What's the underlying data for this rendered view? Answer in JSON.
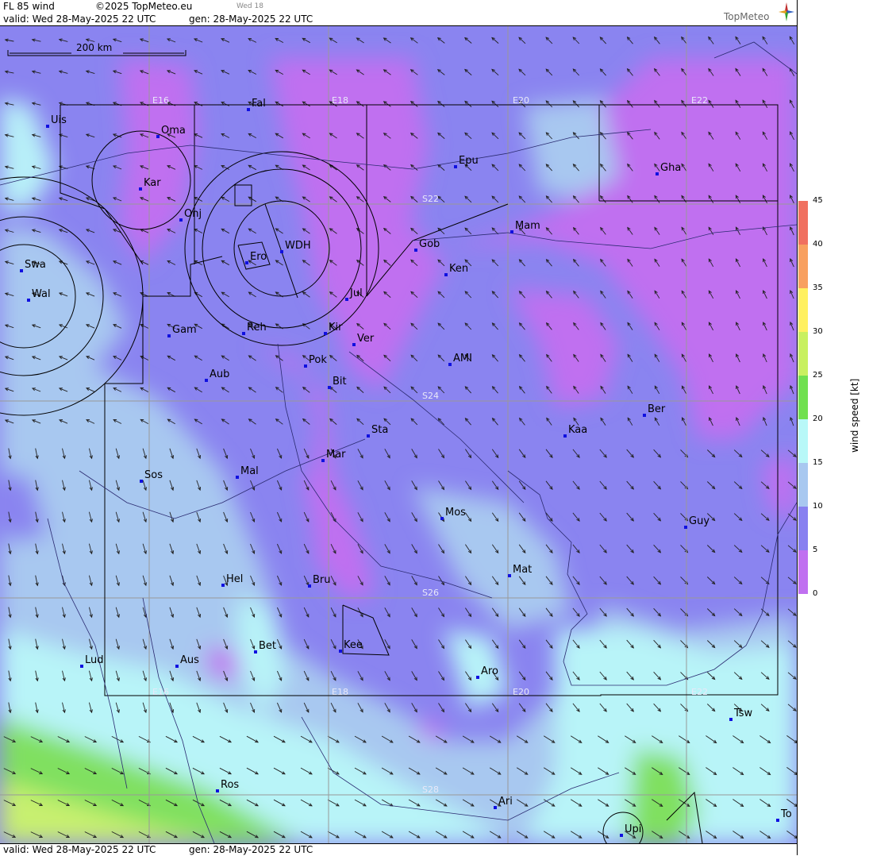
{
  "header": {
    "product": "FL 85 wind",
    "copyright": "©2025 TopMeteo.eu",
    "step": "Wed 18",
    "valid_label": "valid:  Wed  28-May-2025  22 UTC",
    "gen_label": "gen: 28-May-2025 22 UTC",
    "brand": "TopMeteo"
  },
  "footer": {
    "valid_label": "valid:  Wed  28-May-2025  22 UTC",
    "gen_label": "gen: 28-May-2025 22 UTC"
  },
  "scale_bar": {
    "label": "200 km"
  },
  "grid_labels": {
    "lon": [
      "E16",
      "E18",
      "E20",
      "E22"
    ],
    "lat": [
      "S22",
      "S24",
      "S26",
      "S28"
    ]
  },
  "places": [
    "Uis",
    "Fal",
    "Oma",
    "Kar",
    "Onj",
    "Epu",
    "Gha",
    "Mam",
    "Gob",
    "Ken",
    "WDH",
    "Ero",
    "Swa",
    "Wal",
    "Jul",
    "Gam",
    "Reh",
    "Kir",
    "Ver",
    "Pok",
    "AMI",
    "Bit",
    "Aub",
    "Ber",
    "Sta",
    "Kaa",
    "Mar",
    "Sos",
    "Mal",
    "Mos",
    "Guy",
    "Hel",
    "Mat",
    "Bru",
    "Bet",
    "Kee",
    "Lud",
    "Aus",
    "Aro",
    "Tsw",
    "Ros",
    "Ari",
    "Upi",
    "To"
  ],
  "colorbar": {
    "title": "wind speed [kt]",
    "ticks": [
      "45",
      "40",
      "35",
      "30",
      "25",
      "20",
      "15",
      "10",
      "5",
      "0"
    ],
    "colors": [
      "#f07060",
      "#f8a060",
      "#fff060",
      "#c8f060",
      "#70e050",
      "#b8f8f8",
      "#a8c8f0",
      "#8880f0",
      "#c070f0"
    ]
  }
}
